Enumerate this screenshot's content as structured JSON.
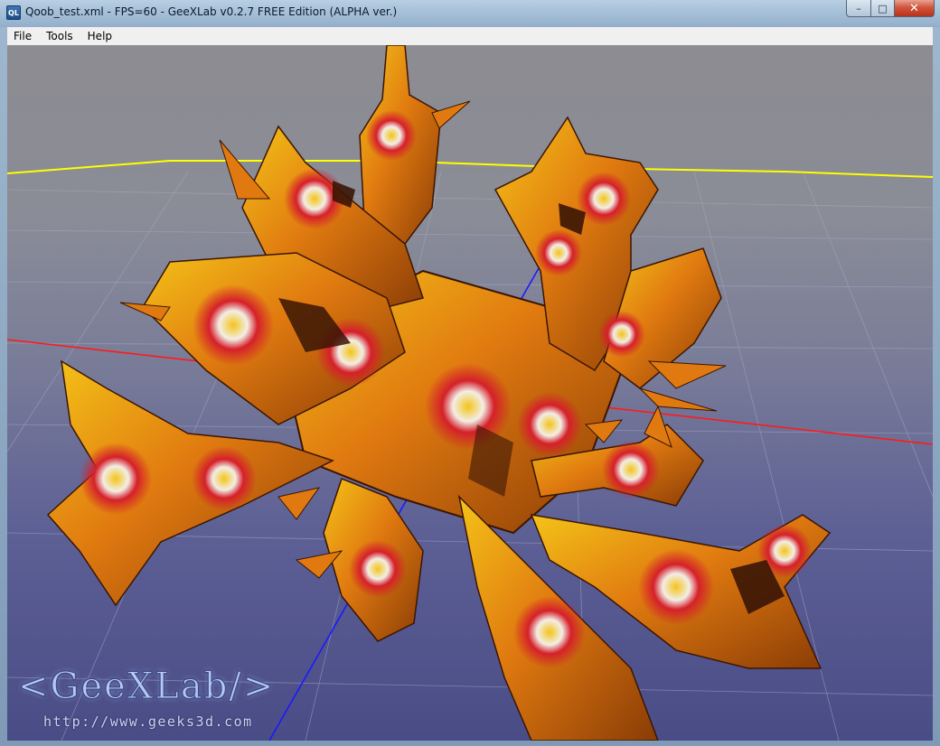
{
  "window": {
    "icon_label": "QL",
    "title": "Qoob_test.xml - FPS=60 - GeeXLab v0.2.7 FREE Edition (ALPHA ver.)",
    "buttons": {
      "minimize": "–",
      "maximize": "□",
      "close": "✕"
    }
  },
  "menu": {
    "items": [
      {
        "label": "File"
      },
      {
        "label": "Tools"
      },
      {
        "label": "Help"
      }
    ]
  },
  "viewport": {
    "logo_text": "<GeeXLab/>",
    "logo_url": "http://www.geeks3d.com",
    "axis_colors": {
      "x_axis": "#ff1a1a",
      "y_axis": "#1a1aff",
      "horizon": "#ffff00"
    },
    "shape_colors": {
      "orange": "#e07a10",
      "yellow": "#f4c318",
      "red": "#d5202a",
      "white": "#f2eee6",
      "shadow": "#3a1505"
    }
  }
}
